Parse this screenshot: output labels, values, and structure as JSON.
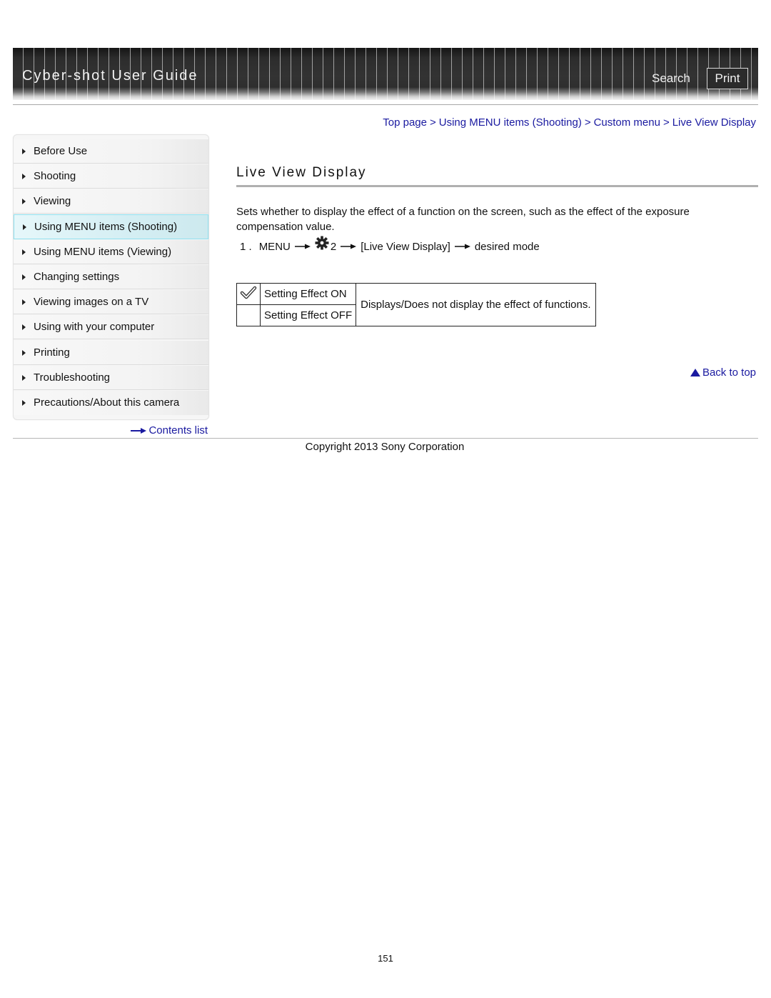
{
  "header": {
    "title": "Cyber-shot User Guide",
    "search_label": "Search",
    "print_label": "Print"
  },
  "breadcrumb": {
    "items": [
      "Top page",
      "Using MENU items (Shooting)",
      "Custom menu",
      "Live View Display"
    ],
    "separator": ">"
  },
  "sidebar": {
    "items": [
      {
        "label": "Before Use",
        "active": false
      },
      {
        "label": "Shooting",
        "active": false
      },
      {
        "label": "Viewing",
        "active": false
      },
      {
        "label": "Using MENU items (Shooting)",
        "active": true
      },
      {
        "label": "Using MENU items (Viewing)",
        "active": false
      },
      {
        "label": "Changing settings",
        "active": false
      },
      {
        "label": "Viewing images on a TV",
        "active": false
      },
      {
        "label": "Using with your computer",
        "active": false
      },
      {
        "label": "Printing",
        "active": false
      },
      {
        "label": "Troubleshooting",
        "active": false
      },
      {
        "label": "Precautions/About this camera",
        "active": false
      }
    ],
    "contents_link": "Contents list"
  },
  "main": {
    "title": "Live View Display",
    "description": "Sets whether to display the effect of a function on the screen, such as the effect of the exposure compensation value.",
    "step": {
      "number": "1 .",
      "menu": "MENU",
      "tab_icon": "gear-icon",
      "tab_number": "2",
      "item": "[Live View Display]",
      "target": "desired mode"
    },
    "settings_table": {
      "rows": [
        {
          "icon": "checkmark-icon",
          "name": "Setting Effect ON"
        },
        {
          "icon": "",
          "name": "Setting Effect OFF"
        }
      ],
      "description": "Displays/Does not display the effect of functions."
    },
    "back_to_top": "Back to top"
  },
  "footer": {
    "copyright": "Copyright 2013 Sony Corporation",
    "page_number": "151"
  },
  "colors": {
    "link": "#1a1aa0",
    "header_bg": "#333333",
    "active_nav_border": "#8fe0ef"
  }
}
